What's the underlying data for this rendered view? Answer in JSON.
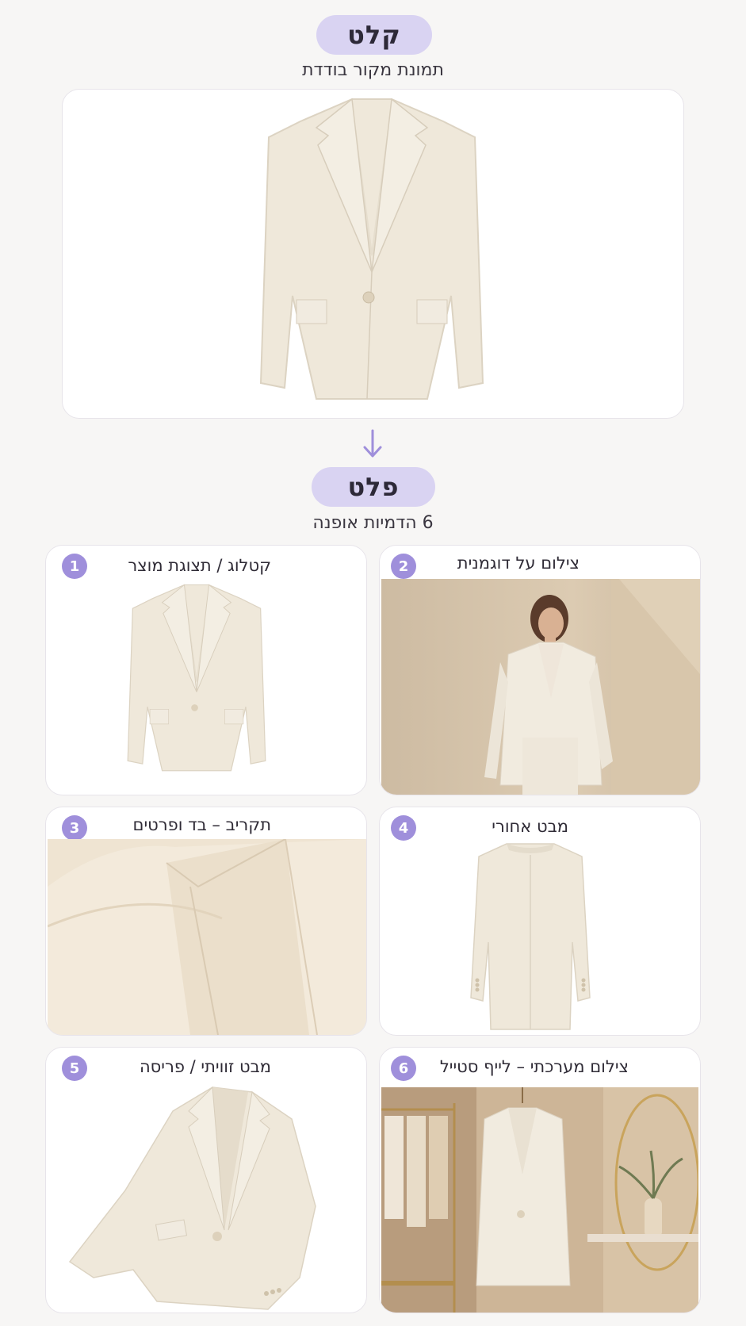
{
  "before": {
    "label": "קלט",
    "subtitle": "תמונת מקור בודדת"
  },
  "arrow_icon": "arrow-down-icon",
  "after": {
    "label": "פלט",
    "subtitle": "6 הדמיות אופנה"
  },
  "panels": [
    {
      "number": "1",
      "title": "קטלוג / תצוגת מוצר"
    },
    {
      "number": "2",
      "title": "צילום על דוגמנית"
    },
    {
      "number": "3",
      "title": "תקריב – בד ופרטים"
    },
    {
      "number": "4",
      "title": "מבט אחורי"
    },
    {
      "number": "5",
      "title": "מבט זוויתי / פריסה"
    },
    {
      "number": "6",
      "title": "צילום מערכתי – לייף סטייל"
    }
  ],
  "colors": {
    "accent": "#9f8fdb",
    "pill": "#d9d3f2",
    "garment": "#efe8da"
  }
}
